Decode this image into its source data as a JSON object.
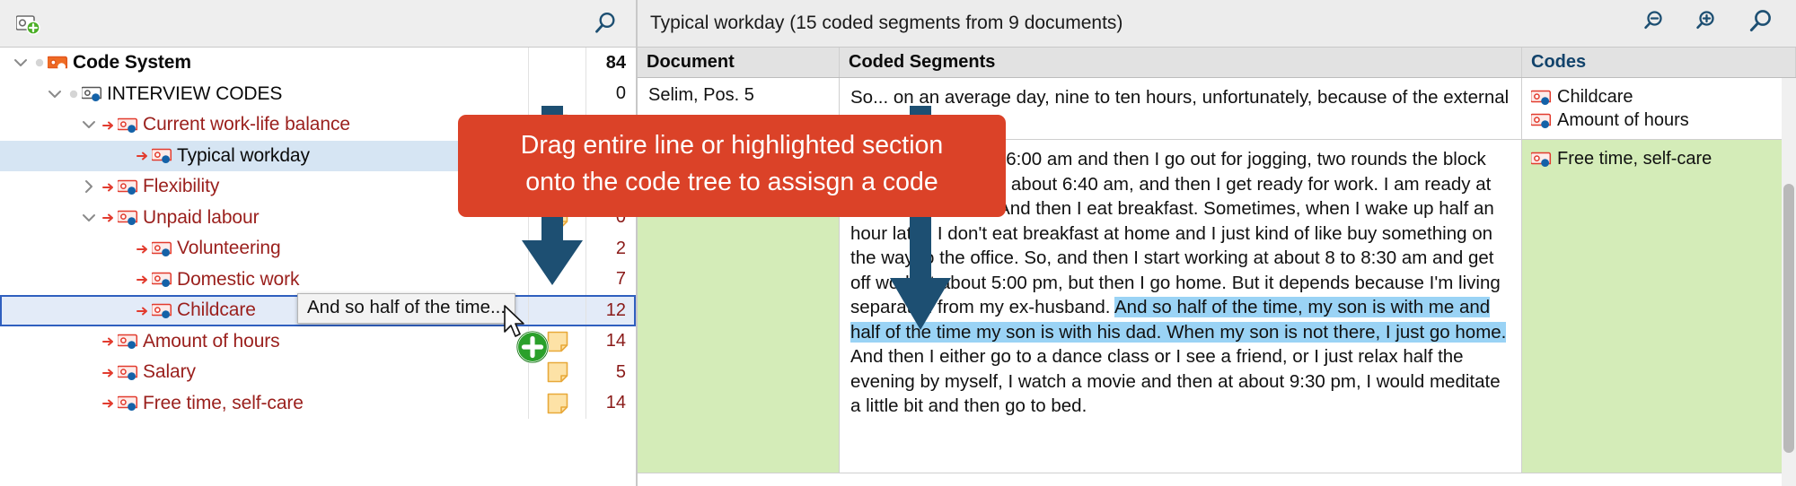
{
  "left_panel": {
    "toolbar": {
      "new_code_icon": "new-code-icon",
      "search_icon": "search-icon"
    },
    "tree": [
      {
        "label": "Code System",
        "indent": 0,
        "caret": "down",
        "dot": true,
        "arrow": false,
        "icon": "code-system-icon",
        "style": "root",
        "count": "84",
        "memo": false
      },
      {
        "label": "INTERVIEW CODES",
        "indent": 1,
        "caret": "down",
        "dot": true,
        "arrow": false,
        "icon": "code-icon-blue",
        "style": "lvl1",
        "count": "0",
        "memo": false
      },
      {
        "label": "Current work-life balance",
        "indent": 2,
        "caret": "down",
        "dot": false,
        "arrow": true,
        "icon": "code-icon-red",
        "style": "red",
        "count": "",
        "memo": true
      },
      {
        "label": "Typical workday",
        "indent": 3,
        "caret": "none",
        "dot": false,
        "arrow": true,
        "icon": "code-icon-red",
        "style": "black",
        "count": "",
        "memo": false,
        "selected": true
      },
      {
        "label": "Flexibility",
        "indent": 2,
        "caret": "right",
        "dot": false,
        "arrow": true,
        "icon": "code-icon-red",
        "style": "red",
        "count": "",
        "memo": false
      },
      {
        "label": "Unpaid labour",
        "indent": 2,
        "caret": "down",
        "dot": false,
        "arrow": true,
        "icon": "code-icon-red",
        "style": "red",
        "count": "0",
        "memo": true
      },
      {
        "label": "Volunteering",
        "indent": 3,
        "caret": "none",
        "dot": false,
        "arrow": true,
        "icon": "code-icon-red",
        "style": "red",
        "count": "2",
        "memo": false
      },
      {
        "label": "Domestic work",
        "indent": 3,
        "caret": "none",
        "dot": false,
        "arrow": true,
        "icon": "code-icon-red",
        "style": "red",
        "count": "7",
        "memo": false
      },
      {
        "label": "Childcare",
        "indent": 3,
        "caret": "none",
        "dot": false,
        "arrow": true,
        "icon": "code-icon-red",
        "style": "red",
        "count": "12",
        "memo": false,
        "drop_target": true
      },
      {
        "label": "Amount of hours",
        "indent": 2,
        "caret": "none",
        "dot": false,
        "arrow": true,
        "icon": "code-icon-red",
        "style": "red",
        "count": "14",
        "memo": true
      },
      {
        "label": "Salary",
        "indent": 2,
        "caret": "none",
        "dot": false,
        "arrow": true,
        "icon": "code-icon-red",
        "style": "red",
        "count": "5",
        "memo": true
      },
      {
        "label": "Free time, self-care",
        "indent": 2,
        "caret": "none",
        "dot": false,
        "arrow": true,
        "icon": "code-icon-red",
        "style": "red",
        "count": "14",
        "memo": true
      }
    ]
  },
  "right_panel": {
    "title": "Typical workday (15 coded segments from 9 documents)",
    "icons": [
      {
        "name": "zoom-out-icon"
      },
      {
        "name": "zoom-in-icon"
      },
      {
        "name": "search-icon"
      }
    ],
    "columns": {
      "document": "Document",
      "segments": "Coded Segments",
      "codes": "Codes"
    },
    "rows": [
      {
        "document": "Selim, Pos. 5",
        "green": false,
        "segment_parts": [
          {
            "text": "So... on an average day, nine to ten hours, unfortunately, because of the external appointments.",
            "highlight": false
          }
        ],
        "codes": [
          "Childcare",
          "Amount of hours"
        ]
      },
      {
        "document": "",
        "green": true,
        "segment_parts": [
          {
            "text": "I wake up at about 6:00 am and then I go out for jogging, two rounds the block and I come back at about 6:40 am, and then I get ready for work. I am ready at about 7, 7:15 am. And then I eat breakfast. Sometimes, when I wake up half an hour later, I don't eat breakfast at home and I just kind of like buy something on the way to the office. So, and then I start working at about 8 to 8:30 am and get off work at about 5:00 pm, but then I go home. But it depends because I'm living separated from my ex-husband. ",
            "highlight": false
          },
          {
            "text": "And so half of the time, my son is with me and half of the time my son is with his dad. When my son is not there, I just go home.",
            "highlight": true
          },
          {
            "text": " And then I either go to a dance class or I see a friend, or I just relax half the evening by myself, I watch a movie and then at about 9:30 pm, I would meditate a little bit and then go to bed.",
            "highlight": false
          }
        ],
        "codes": [
          "Free time, self-care"
        ]
      }
    ]
  },
  "overlay": {
    "callout_line1": "Drag entire line or highlighted section",
    "callout_line2": "onto the code tree to assisgn a code",
    "drag_ghost_text": "And so half of the time...",
    "arrow_color": "#1d4f72",
    "callout_color": "#db4228",
    "plus_badge": "add-plus-badge-icon",
    "cursor": "cursor-arrow-icon"
  },
  "colors": {
    "accent_red": "#db4228",
    "highlight_blue": "#9ad3f5",
    "row_green": "#d4ecb8",
    "selection_blue": "#d6e5f3",
    "code_red": "#9a1f1c",
    "codes_header": "#12436b"
  }
}
